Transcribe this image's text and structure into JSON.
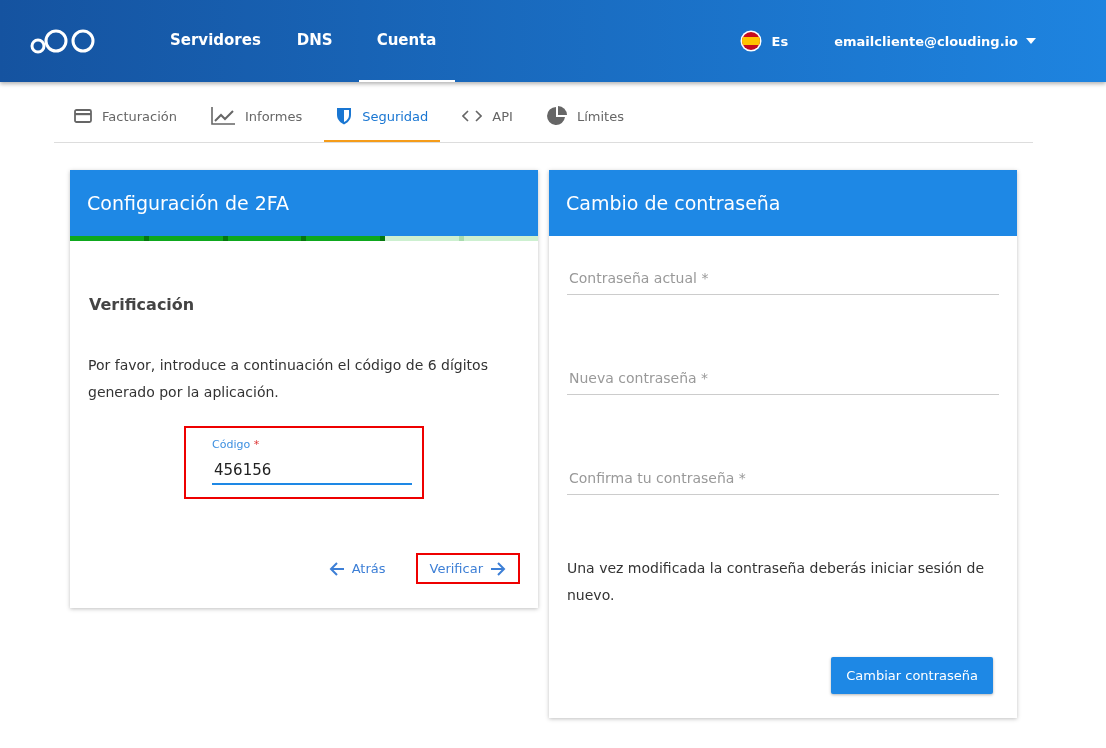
{
  "header": {
    "nav": [
      {
        "label": "Servidores",
        "selected": false
      },
      {
        "label": "DNS",
        "selected": false
      },
      {
        "label": "Cuenta",
        "selected": true
      }
    ],
    "language": "Es",
    "account": "emailcliente@clouding.io"
  },
  "tabs": [
    {
      "kind": "card",
      "label": "Facturación",
      "selected": false
    },
    {
      "kind": "chart",
      "label": "Informes",
      "selected": false
    },
    {
      "kind": "shield",
      "label": "Seguridad",
      "selected": true
    },
    {
      "kind": "code",
      "label": "API",
      "selected": false
    },
    {
      "kind": "pie",
      "label": "Límites",
      "selected": false
    }
  ],
  "twofa": {
    "title": "Configuración de 2FA",
    "steps": [
      {
        "done": true
      },
      {
        "done": true
      },
      {
        "done": true
      },
      {
        "done": true
      },
      {
        "done": false
      },
      {
        "done": false
      }
    ],
    "subtitle": "Verificación",
    "text": "Por favor, introduce a continuación el código de 6 dígitos generado por la aplicación.",
    "code_field": {
      "label": "Código",
      "required_mark": "*",
      "value": "456156",
      "highlighted": true
    },
    "back_button": {
      "label": "Atrás",
      "highlighted": false
    },
    "verify_button": {
      "label": "Verificar",
      "highlighted": true
    }
  },
  "password": {
    "title": "Cambio de contraseña",
    "fields": [
      {
        "placeholder": "Contraseña actual *"
      },
      {
        "placeholder": "Nueva contraseña *"
      },
      {
        "placeholder": "Confirma tu contraseña *"
      }
    ],
    "note": "Una vez modificada la contraseña deberás iniciar sesión de nuevo.",
    "button": "Cambiar contraseña"
  }
}
